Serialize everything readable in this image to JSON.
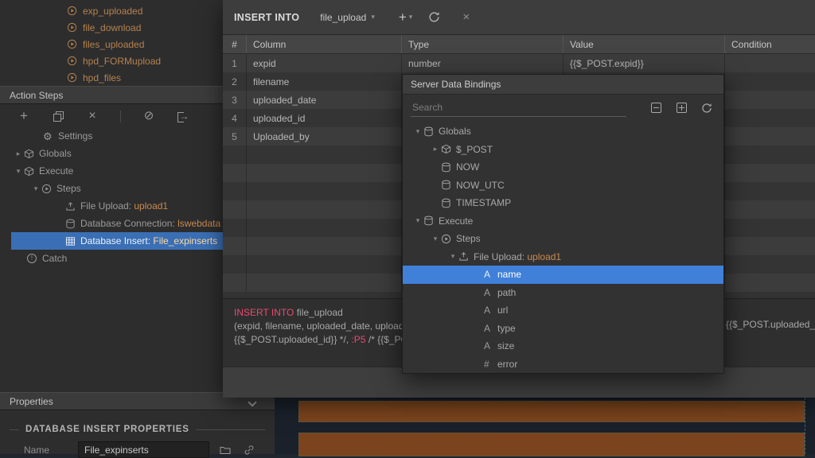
{
  "colors": {
    "accent_blue": "#4080d8",
    "selected_step_blue": "#3a6fb5",
    "value_orange": "#c98a4e",
    "sql_keyword_pink": "#e84a6f",
    "stage_row_orange": "#7b441e"
  },
  "explorer": {
    "items": [
      {
        "label": "exp_uploaded"
      },
      {
        "label": "file_download"
      },
      {
        "label": "files_uploaded"
      },
      {
        "label": "hpd_FORMupload"
      },
      {
        "label": "hpd_files"
      }
    ]
  },
  "action_steps": {
    "title": "Action Steps",
    "settings": "Settings",
    "globals": "Globals",
    "execute": "Execute",
    "steps": "Steps",
    "file_upload": {
      "prefix": "File Upload: ",
      "value": "upload1"
    },
    "db_connection": {
      "prefix": "Database Connection: ",
      "value": "lswebdata"
    },
    "db_insert": {
      "prefix": "Database Insert: ",
      "value": "File_expinserts"
    },
    "catch": "Catch"
  },
  "properties": {
    "title": "Properties",
    "section": "DATABASE INSERT PROPERTIES",
    "name_label": "Name",
    "name_value": "File_expinserts"
  },
  "dialog": {
    "title": "INSERT INTO",
    "table_name": "file_upload",
    "columns": [
      "#",
      "Column",
      "Type",
      "Value",
      "Condition"
    ],
    "rows": [
      {
        "num": "1",
        "column": "expid",
        "type": "number",
        "value": "{{$_POST.expid}}"
      },
      {
        "num": "2",
        "column": "filename"
      },
      {
        "num": "3",
        "column": "uploaded_date"
      },
      {
        "num": "4",
        "column": "uploaded_id"
      },
      {
        "num": "5",
        "column": "Uploaded_by"
      }
    ],
    "sql": {
      "keyword": "INSERT INTO",
      "line1_rest": " file_upload",
      "line2": "(expid, filename, uploaded_date, uploaded_i",
      "line3_a": "{{$_POST.uploaded_id}} */, ",
      "line3_kw": ":P5",
      "line3_b": " /* {{$_POST.U",
      "right_fragment": "{{$_POST.uploaded_"
    }
  },
  "popup": {
    "title": "Server Data Bindings",
    "search_placeholder": "Search",
    "tree": {
      "globals": "Globals",
      "post": "$_POST",
      "now": "NOW",
      "now_utc": "NOW_UTC",
      "timestamp": "TIMESTAMP",
      "execute": "Execute",
      "steps": "Steps",
      "file_upload": {
        "prefix": "File Upload: ",
        "value": "upload1"
      },
      "fields": [
        {
          "label": "name"
        },
        {
          "label": "path"
        },
        {
          "label": "url"
        },
        {
          "label": "type"
        },
        {
          "label": "size"
        },
        {
          "label": "error"
        }
      ]
    }
  }
}
